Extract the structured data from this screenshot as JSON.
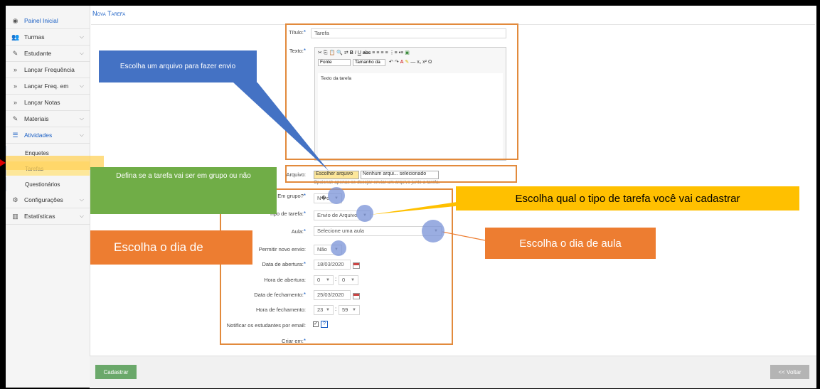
{
  "sidebar": {
    "items": [
      {
        "label": "Painel Inicial",
        "icon": "dashboard-icon"
      },
      {
        "label": "Turmas",
        "icon": "users-icon"
      },
      {
        "label": "Estudante",
        "icon": "edit-icon"
      },
      {
        "label": "Lançar Frequência",
        "icon": "double-chevron-icon"
      },
      {
        "label": "Lançar Freq. em",
        "icon": "double-chevron-icon"
      },
      {
        "label": "Lançar Notas",
        "icon": "double-chevron-icon"
      },
      {
        "label": "Materiais",
        "icon": "edit-icon"
      },
      {
        "label": "Atividades",
        "icon": "list-icon"
      },
      {
        "label": "Configurações",
        "icon": "cogs-icon"
      },
      {
        "label": "Estatísticas",
        "icon": "chart-icon"
      }
    ],
    "subitems": [
      "Enquetes",
      "Tarefas",
      "Questionários"
    ]
  },
  "page": {
    "title": "Nova Tarefa"
  },
  "form": {
    "titulo_label": "Título:",
    "titulo_value": "Tarefa",
    "texto_label": "Texto:",
    "editor_font": "Fonte",
    "editor_size": "Tamanho da",
    "editor_content": "Texto da tarefa",
    "arquivo_label": "Arquivo:",
    "arquivo_button": "Escolher arquivo",
    "arquivo_status": "Nenhum arqui... selecionado",
    "arquivo_hint": "Opcional: apenas se desejar enviar um arquivo junto a tarefa.",
    "grupo_label": "Em grupo?",
    "grupo_value": "N�o",
    "tipo_label": "Tipo de tarefa:",
    "tipo_value": "Envio de Arquivo",
    "aula_label": "Aula:",
    "aula_value": "Selecione uma aula",
    "novo_envio_label": "Permitir novo envio:",
    "novo_envio_value": "Não",
    "data_abertura_label": "Data de abertura:",
    "data_abertura_value": "18/03/2020",
    "hora_abertura_label": "Hora de abertura:",
    "hora_abertura_h": "0",
    "hora_abertura_m": "0",
    "data_fechamento_label": "Data de fechamento:",
    "data_fechamento_value": "25/03/2020",
    "hora_fechamento_label": "Hora de fechamento:",
    "hora_fechamento_h": "23",
    "hora_fechamento_m": "59",
    "notificar_label": "Notificar os estudantes por email:",
    "notificar_help": "?",
    "criar_label": "Criar em:"
  },
  "buttons": {
    "cadastrar": "Cadastrar",
    "voltar": "<< Voltar"
  },
  "annotations": {
    "arquivo": "Escolha um arquivo para fazer envio",
    "grupo": "Defina se a tarefa vai ser em grupo ou não",
    "tipo": "Escolha qual o tipo de tarefa você vai cadastrar",
    "aula": "Escolha o dia de aula",
    "dia": "Escolha o dia de"
  },
  "colors": {
    "accent": "#1a5fc4",
    "orange": "#ed7d31",
    "blue": "#4472c4",
    "green": "#70ad47",
    "yellow": "#ffc000"
  }
}
